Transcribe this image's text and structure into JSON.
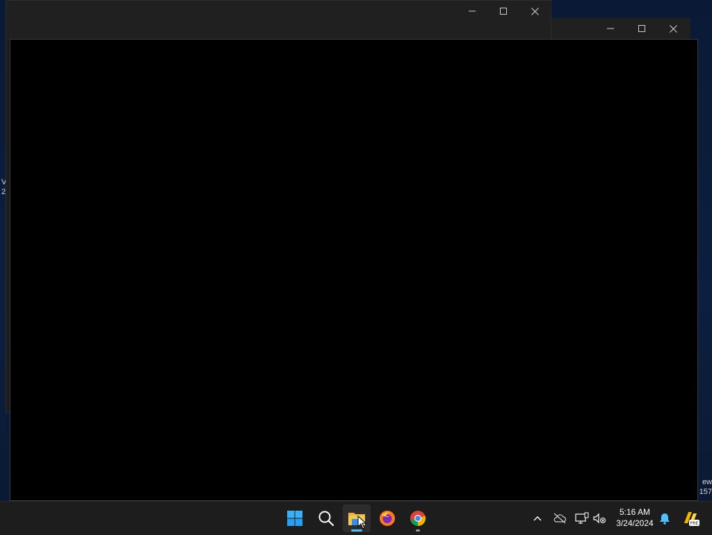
{
  "desktop": {
    "peek_left_lines": [
      "V",
      "2"
    ],
    "peek_right_lines": [
      "ew",
      "157"
    ]
  },
  "windows": {
    "back": {
      "minimize_glyph": "─",
      "maximize_glyph": "□",
      "close_glyph": "✕"
    },
    "middle": {
      "minimize_glyph": "─",
      "maximize_glyph": "□",
      "close_glyph": "✕"
    },
    "front": {}
  },
  "taskbar": {
    "apps": [
      {
        "name": "start-button",
        "icon": "windows-logo-icon"
      },
      {
        "name": "search-button",
        "icon": "search-icon"
      },
      {
        "name": "file-explorer-button",
        "icon": "folder-icon",
        "active": true,
        "indicator_color": "#4cc2ff"
      },
      {
        "name": "firefox-button",
        "icon": "firefox-icon"
      },
      {
        "name": "chrome-button",
        "icon": "chrome-icon",
        "indicator_color": "#9e9e9e"
      }
    ],
    "tray": {
      "chevron": "show-hidden-icons",
      "clock_time": "5:16 AM",
      "clock_date": "3/24/2024"
    }
  },
  "colors": {
    "taskbar_bg": "#1d1d1d",
    "titlebar_bg": "#202020",
    "accent": "#4cc2ff",
    "desktop_bg": "#0a1a36"
  }
}
